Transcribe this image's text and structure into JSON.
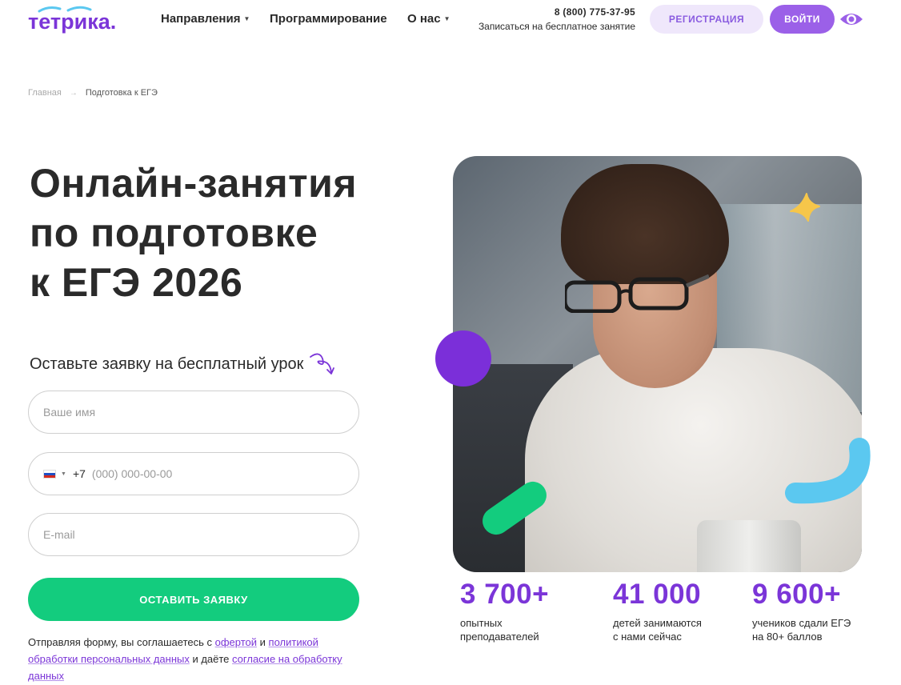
{
  "header": {
    "logo_text": "тетрика.",
    "nav": [
      {
        "label": "Направления",
        "has_dropdown": true
      },
      {
        "label": "Программирование",
        "has_dropdown": false
      },
      {
        "label": "О нас",
        "has_dropdown": true
      }
    ],
    "phone": "8 (800) 775-37-95",
    "trial_link": "Записаться на бесплатное занятие",
    "register_label": "РЕГИСТРАЦИЯ",
    "login_label": "ВОЙТИ",
    "accessibility_icon": "eye-icon"
  },
  "breadcrumb": {
    "home": "Главная",
    "separator": "→",
    "current": "Подготовка к ЕГЭ"
  },
  "hero": {
    "title_lines": [
      "Онлайн-занятия",
      "по подготовке",
      "к ЕГЭ 2026"
    ]
  },
  "form": {
    "caption": "Оставьте заявку на бесплатный урок",
    "name_placeholder": "Ваше имя",
    "phone_prefix": "+7",
    "phone_placeholder": "(000) 000-00-00",
    "email_placeholder": "E-mail",
    "submit_label": "ОСТАВИТЬ ЗАЯВКУ",
    "legal": {
      "t1": "Отправляя форму, вы соглашаетесь с ",
      "link_offer": "офертой",
      "t2": " и ",
      "link_policy": "политикой обработки персональных данных",
      "t3": " и даёте ",
      "link_consent": "согласие на обработку данных"
    }
  },
  "stats": [
    {
      "value": "3 700+",
      "label_l1": "опытных",
      "label_l2": "преподавателей"
    },
    {
      "value": "41 000",
      "label_l1": "детей занимаются",
      "label_l2": "с нами сейчас"
    },
    {
      "value": "9 600+",
      "label_l1": "учеников сдали ЕГЭ",
      "label_l2": "на 80+ баллов"
    }
  ],
  "colors": {
    "brand_purple": "#7b35d8",
    "accent_green": "#13cc7e",
    "accent_blue": "#5bc8f0",
    "star_yellow": "#f6c64a"
  }
}
